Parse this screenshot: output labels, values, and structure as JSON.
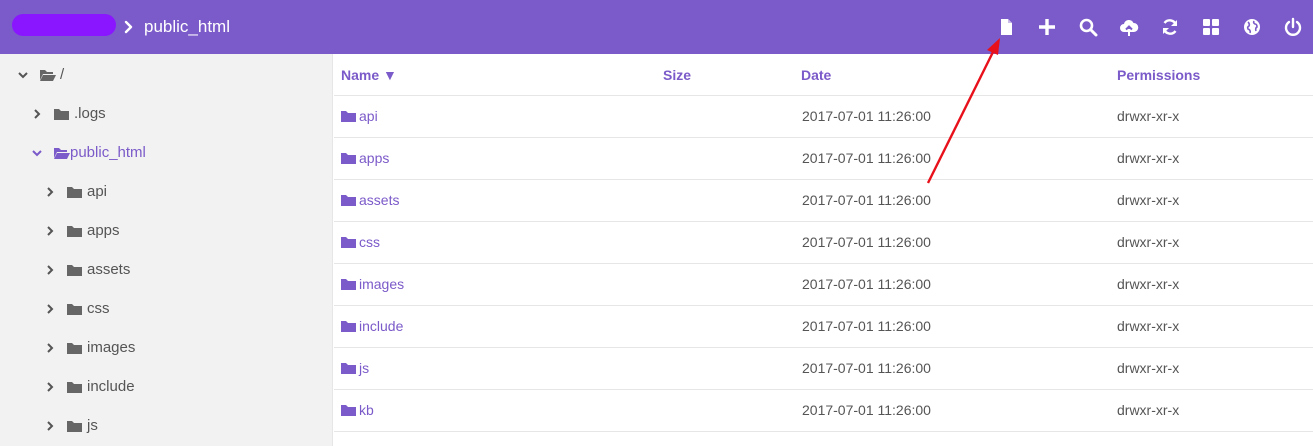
{
  "header": {
    "current_folder": "public_html",
    "accent_color": "#7b5ac9",
    "toolbar_icons": [
      "new-file-icon",
      "plus-icon",
      "search-icon",
      "upload-icon",
      "refresh-icon",
      "grid-icon",
      "globe-icon",
      "power-icon"
    ]
  },
  "sidebar": {
    "items": [
      {
        "label": "/",
        "expanded": true
      },
      {
        "label": ".logs",
        "expanded": false
      },
      {
        "label": "public_html",
        "expanded": true,
        "active": true
      },
      {
        "label": "api",
        "expanded": false
      },
      {
        "label": "apps",
        "expanded": false
      },
      {
        "label": "assets",
        "expanded": false
      },
      {
        "label": "css",
        "expanded": false
      },
      {
        "label": "images",
        "expanded": false
      },
      {
        "label": "include",
        "expanded": false
      },
      {
        "label": "js",
        "expanded": false
      }
    ]
  },
  "table": {
    "columns": [
      "Name ▼",
      "Size",
      "Date",
      "Permissions"
    ],
    "rows": [
      {
        "name": "api",
        "size": "",
        "date": "2017-07-01 11:26:00",
        "permissions": "drwxr-xr-x"
      },
      {
        "name": "apps",
        "size": "",
        "date": "2017-07-01 11:26:00",
        "permissions": "drwxr-xr-x"
      },
      {
        "name": "assets",
        "size": "",
        "date": "2017-07-01 11:26:00",
        "permissions": "drwxr-xr-x"
      },
      {
        "name": "css",
        "size": "",
        "date": "2017-07-01 11:26:00",
        "permissions": "drwxr-xr-x"
      },
      {
        "name": "images",
        "size": "",
        "date": "2017-07-01 11:26:00",
        "permissions": "drwxr-xr-x"
      },
      {
        "name": "include",
        "size": "",
        "date": "2017-07-01 11:26:00",
        "permissions": "drwxr-xr-x"
      },
      {
        "name": "js",
        "size": "",
        "date": "2017-07-01 11:26:00",
        "permissions": "drwxr-xr-x"
      },
      {
        "name": "kb",
        "size": "",
        "date": "2017-07-01 11:26:00",
        "permissions": "drwxr-xr-x"
      }
    ]
  }
}
